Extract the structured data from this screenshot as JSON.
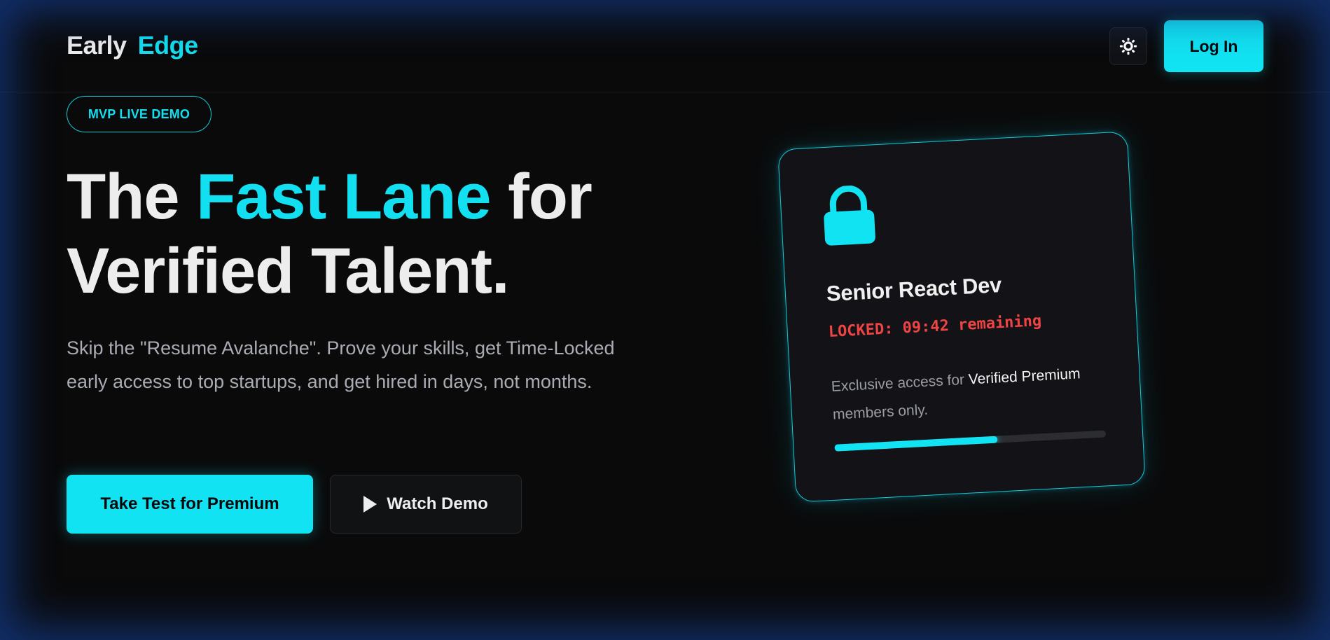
{
  "header": {
    "logo_word1": "Early",
    "logo_word2": "Edge",
    "theme_toggle_icon": "sun-icon",
    "login_label": "Log In"
  },
  "hero": {
    "badge": "MVP LIVE DEMO",
    "headline_part1": "The ",
    "headline_accent": "Fast Lane",
    "headline_part2": " for",
    "headline_line2": "Verified Talent.",
    "subtitle": "Skip the \"Resume Avalanche\". Prove your skills, get Time-Locked early access to top startups, and get hired in days, not months.",
    "cta_primary": "Take Test for Premium",
    "cta_secondary": "Watch Demo",
    "cta_secondary_icon": "play-icon"
  },
  "card": {
    "icon": "lock-icon",
    "title": "Senior React Dev",
    "locked_text": "LOCKED: 09:42 remaining",
    "desc_before": "Exclusive access for ",
    "desc_strong": "Verified Premium",
    "desc_after": " members only.",
    "progress_fraction": 0.6
  },
  "colors": {
    "accent": "#12e3f2",
    "background": "#0a0a0b",
    "locked": "#ef4444"
  }
}
